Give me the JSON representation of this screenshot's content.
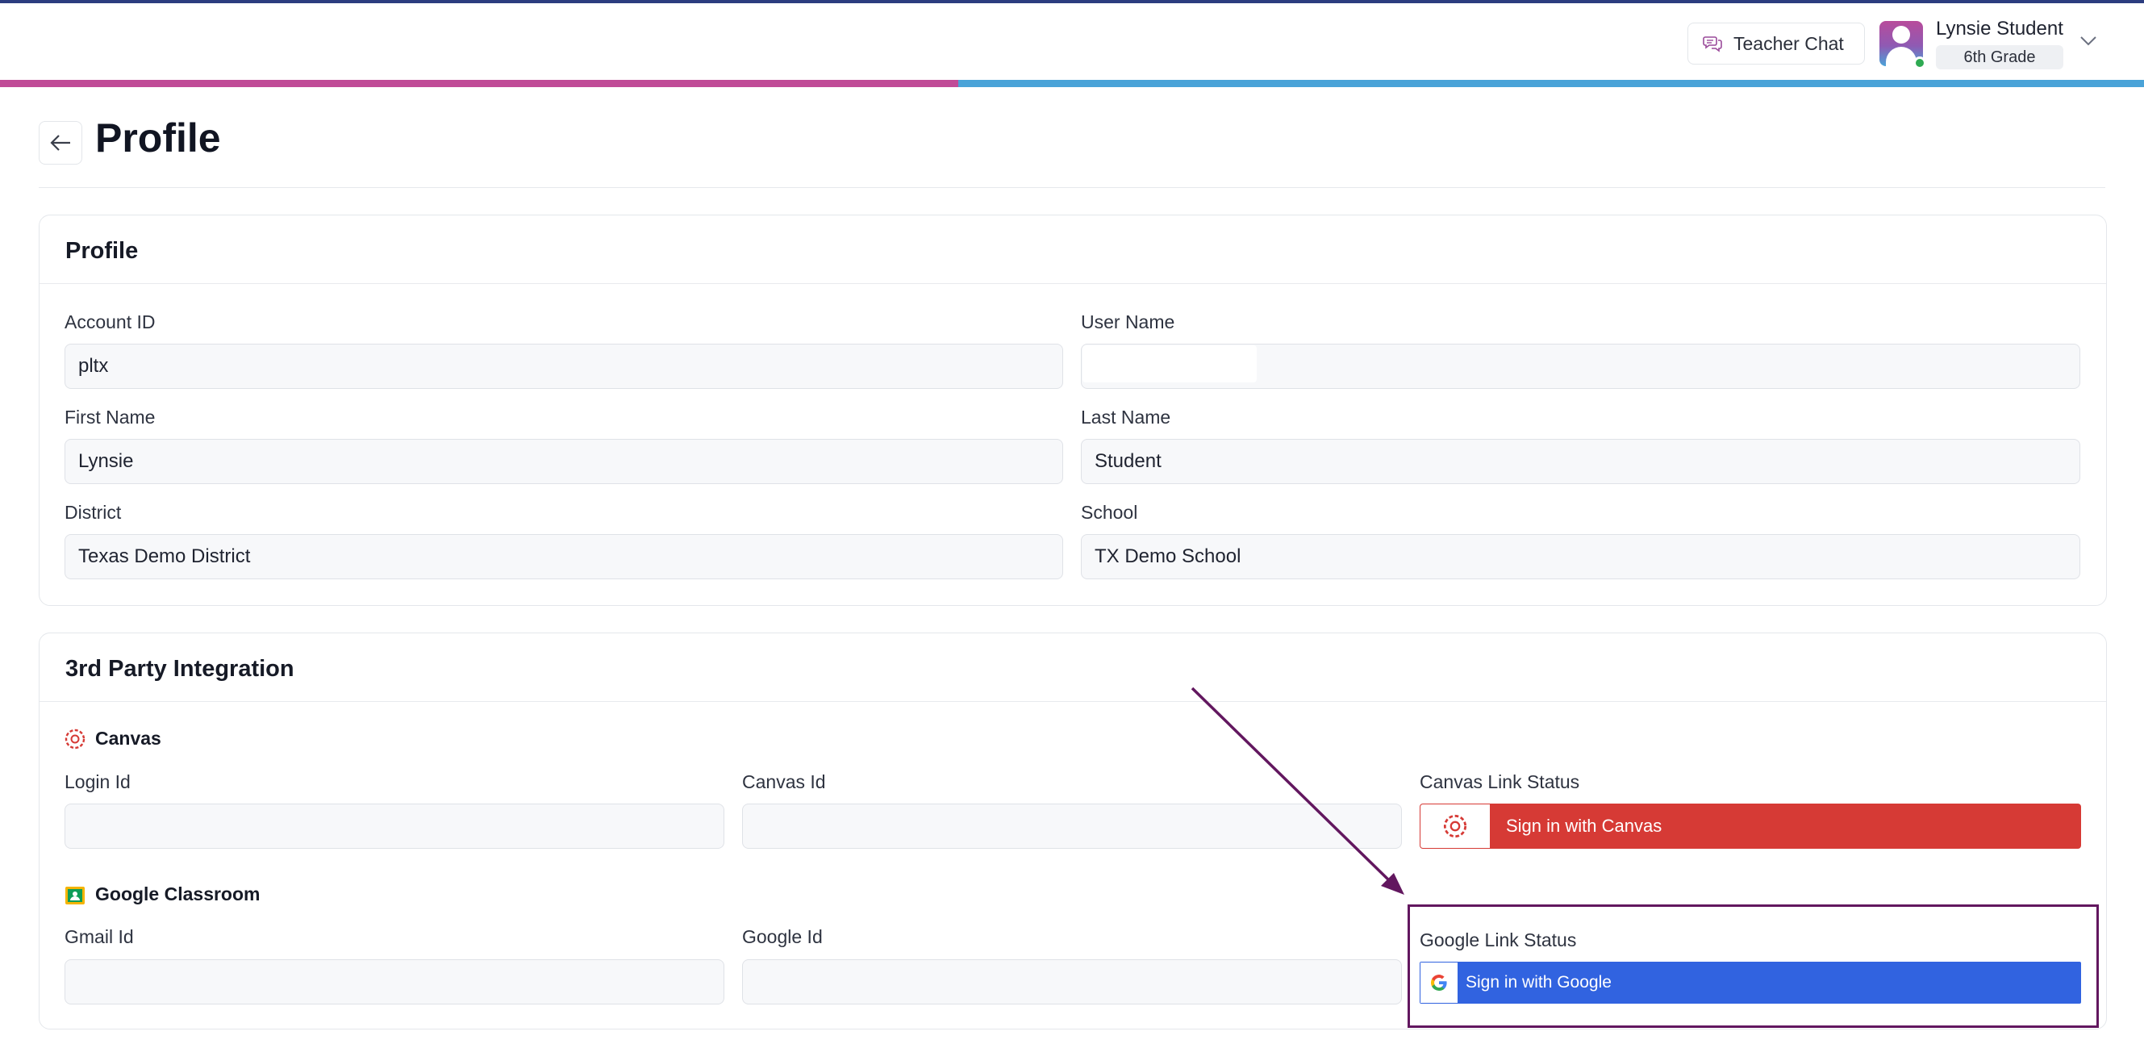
{
  "header": {
    "teacher_chat_label": "Teacher Chat",
    "user_name": "Lynsie Student",
    "grade": "6th Grade",
    "progress_fraction": 0.447
  },
  "page": {
    "title": "Profile"
  },
  "profile_card": {
    "title": "Profile",
    "fields": {
      "account_id": {
        "label": "Account ID",
        "value": "pltx"
      },
      "user_name": {
        "label": "User Name",
        "value": ""
      },
      "first_name": {
        "label": "First Name",
        "value": "Lynsie"
      },
      "last_name": {
        "label": "Last Name",
        "value": "Student"
      },
      "district": {
        "label": "District",
        "value": "Texas Demo District"
      },
      "school": {
        "label": "School",
        "value": "TX Demo School"
      }
    }
  },
  "integration_card": {
    "title": "3rd Party Integration",
    "canvas": {
      "section_label": "Canvas",
      "login_id_label": "Login Id",
      "login_id_value": "",
      "canvas_id_label": "Canvas Id",
      "canvas_id_value": "",
      "status_label": "Canvas Link Status",
      "button_label": "Sign in with Canvas"
    },
    "google": {
      "section_label": "Google Classroom",
      "gmail_id_label": "Gmail Id",
      "gmail_id_value": "",
      "google_id_label": "Google Id",
      "google_id_value": "",
      "status_label": "Google Link Status",
      "button_label": "Sign in with Google"
    }
  },
  "colors": {
    "progress_fill": "#c04b97",
    "progress_track": "#4aa3d8",
    "canvas_red": "#d63a35",
    "google_blue": "#3163e0",
    "annotation_purple": "#62175f",
    "online_green": "#2eaa52"
  }
}
